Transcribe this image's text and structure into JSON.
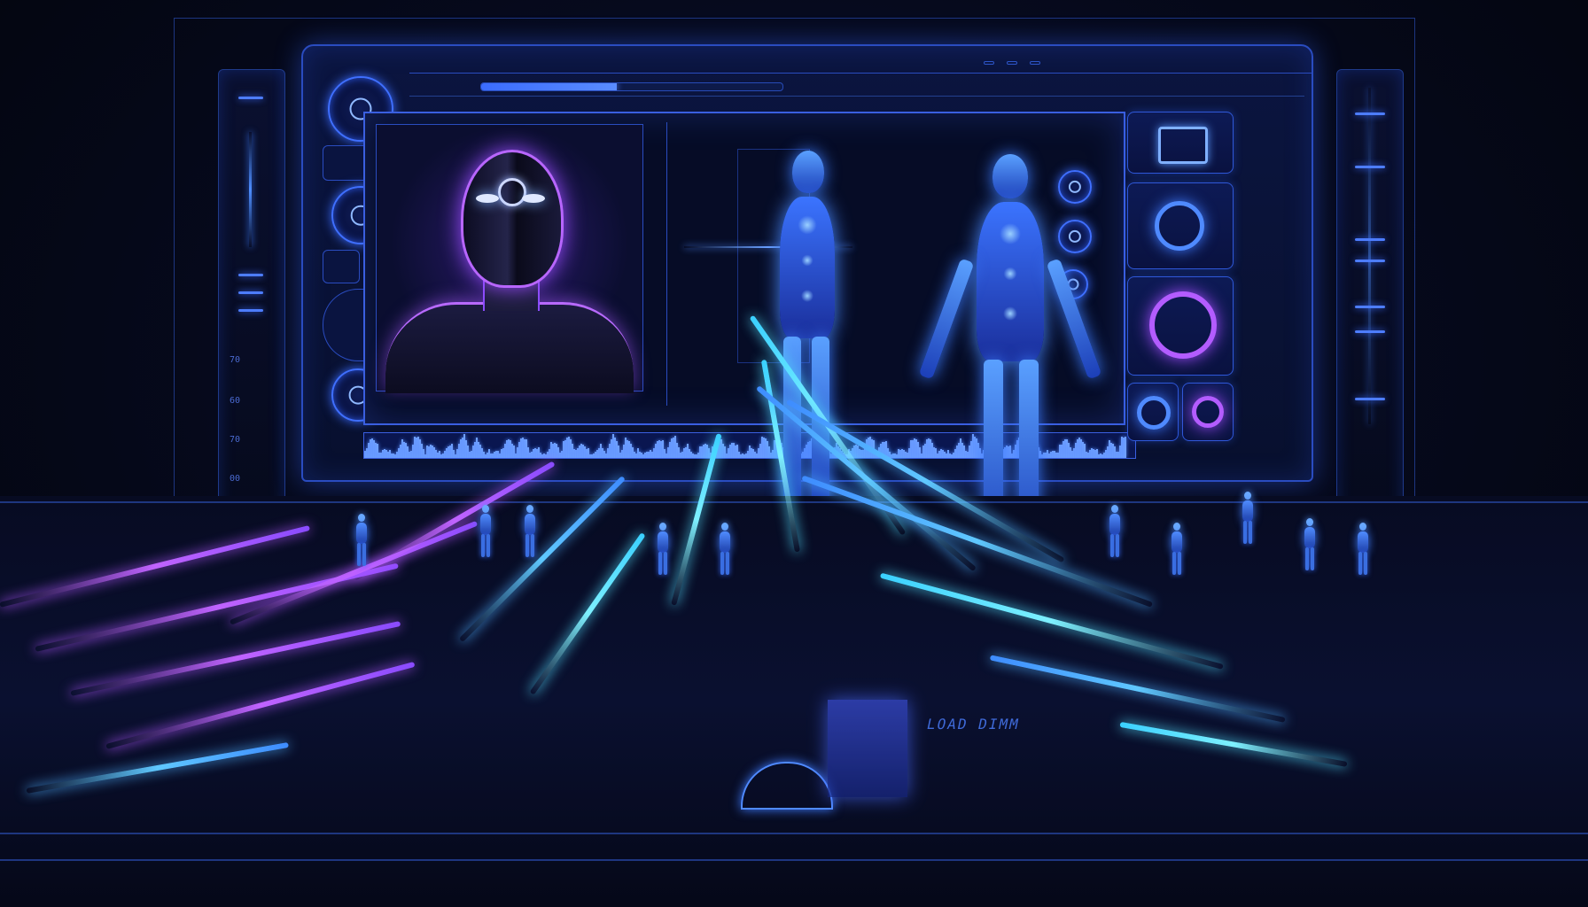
{
  "colors": {
    "background": "#04050f",
    "accent_blue": "#3d7cff",
    "accent_purple": "#b056ff",
    "accent_cyan": "#55e0ff",
    "panel": "#0b1540"
  },
  "left_rail": {
    "tick_labels": [
      "70",
      "60",
      "70",
      "00"
    ]
  },
  "floor_label": "LOAD DIMM",
  "progress_fraction": 0.45,
  "icons": {
    "knob_1": "dial-icon",
    "knob_2": "dial-icon",
    "knob_3": "dial-icon",
    "right_ring": "ring-icon"
  }
}
